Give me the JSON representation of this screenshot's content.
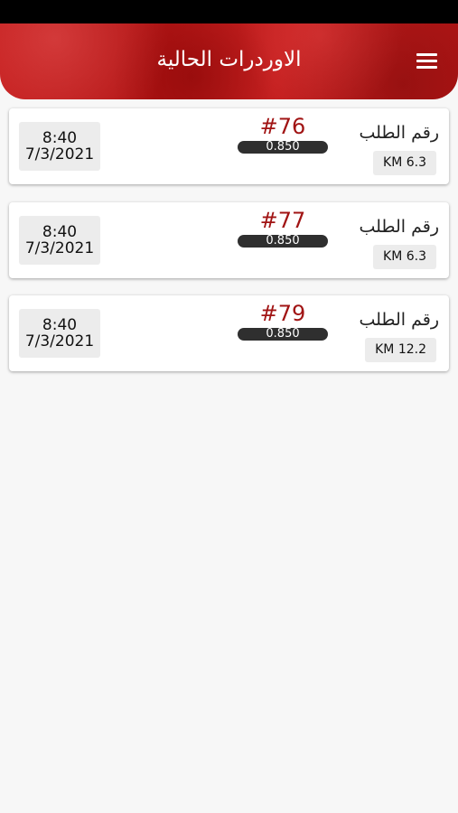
{
  "header": {
    "title": "الاوردرات الحالية",
    "menu_icon": "hamburger-menu-icon"
  },
  "orders": [
    {
      "time": "8:40",
      "date": "7/3/2021",
      "number": "#76",
      "amount": "0.850",
      "label": "رقم الطلب",
      "distance": "KM 6.3"
    },
    {
      "time": "8:40",
      "date": "7/3/2021",
      "number": "#77",
      "amount": "0.850",
      "label": "رقم الطلب",
      "distance": "KM 6.3"
    },
    {
      "time": "8:40",
      "date": "7/3/2021",
      "number": "#79",
      "amount": "0.850",
      "label": "رقم الطلب",
      "distance": "KM 12.2"
    }
  ],
  "colors": {
    "header_red": "#b51717",
    "order_number": "#a11414",
    "amount_pill": "#2f2f2f",
    "background": "#f7f7f7"
  }
}
